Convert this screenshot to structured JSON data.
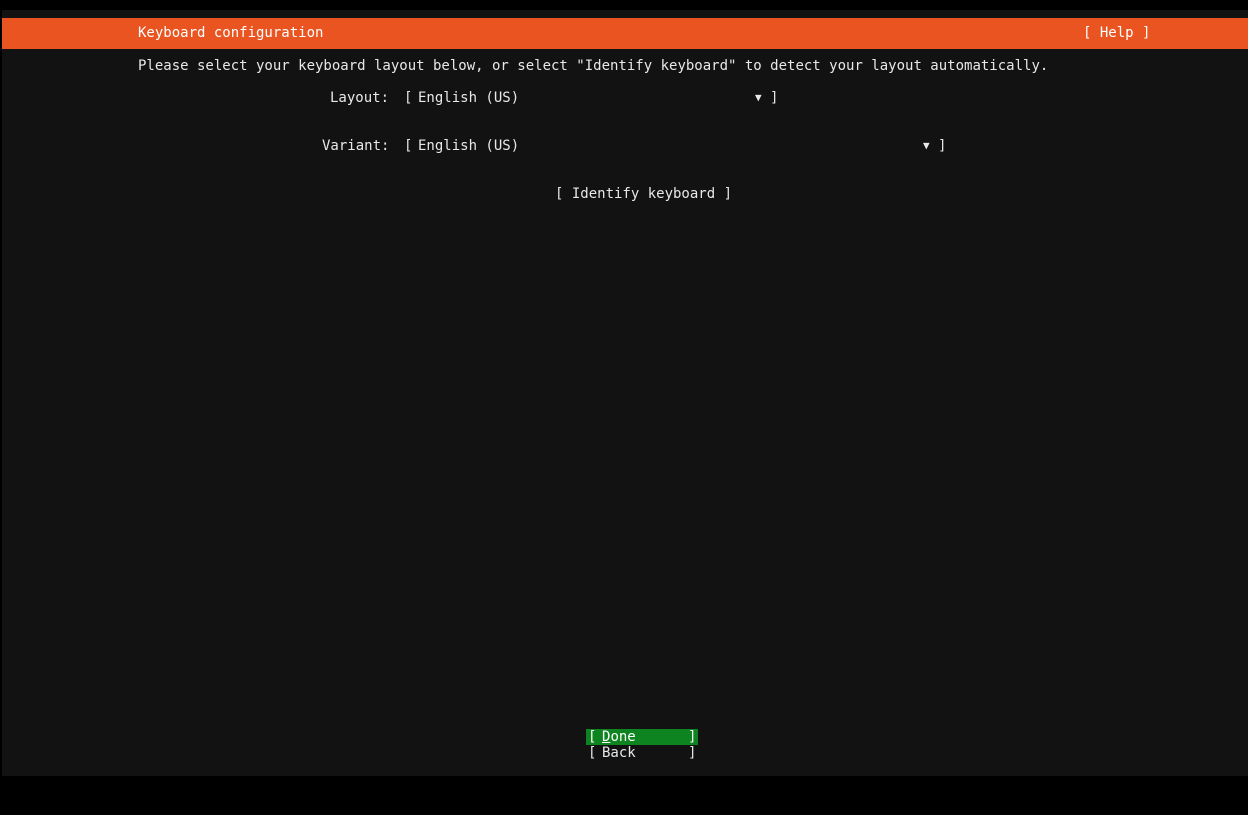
{
  "header": {
    "title": "Keyboard configuration",
    "help_label": "[ Help ]"
  },
  "instructions": "Please select your keyboard layout below, or select \"Identify keyboard\" to detect your layout automatically.",
  "layout": {
    "label": "Layout:",
    "value": "English (US)"
  },
  "variant": {
    "label": "Variant:",
    "value": "English (US)"
  },
  "identify_button": "[ Identify keyboard ]",
  "buttons": {
    "done_first": "D",
    "done_rest": "one",
    "back": "Back"
  },
  "colors": {
    "accent": "#e95420",
    "done_highlight": "#0e8420",
    "background": "#121212"
  },
  "icons": {
    "dropdown": "dropdown-arrow-icon"
  },
  "glyphs": {
    "bracket_open": "[",
    "bracket_close": "]",
    "dropdown_arrow": "▼"
  }
}
